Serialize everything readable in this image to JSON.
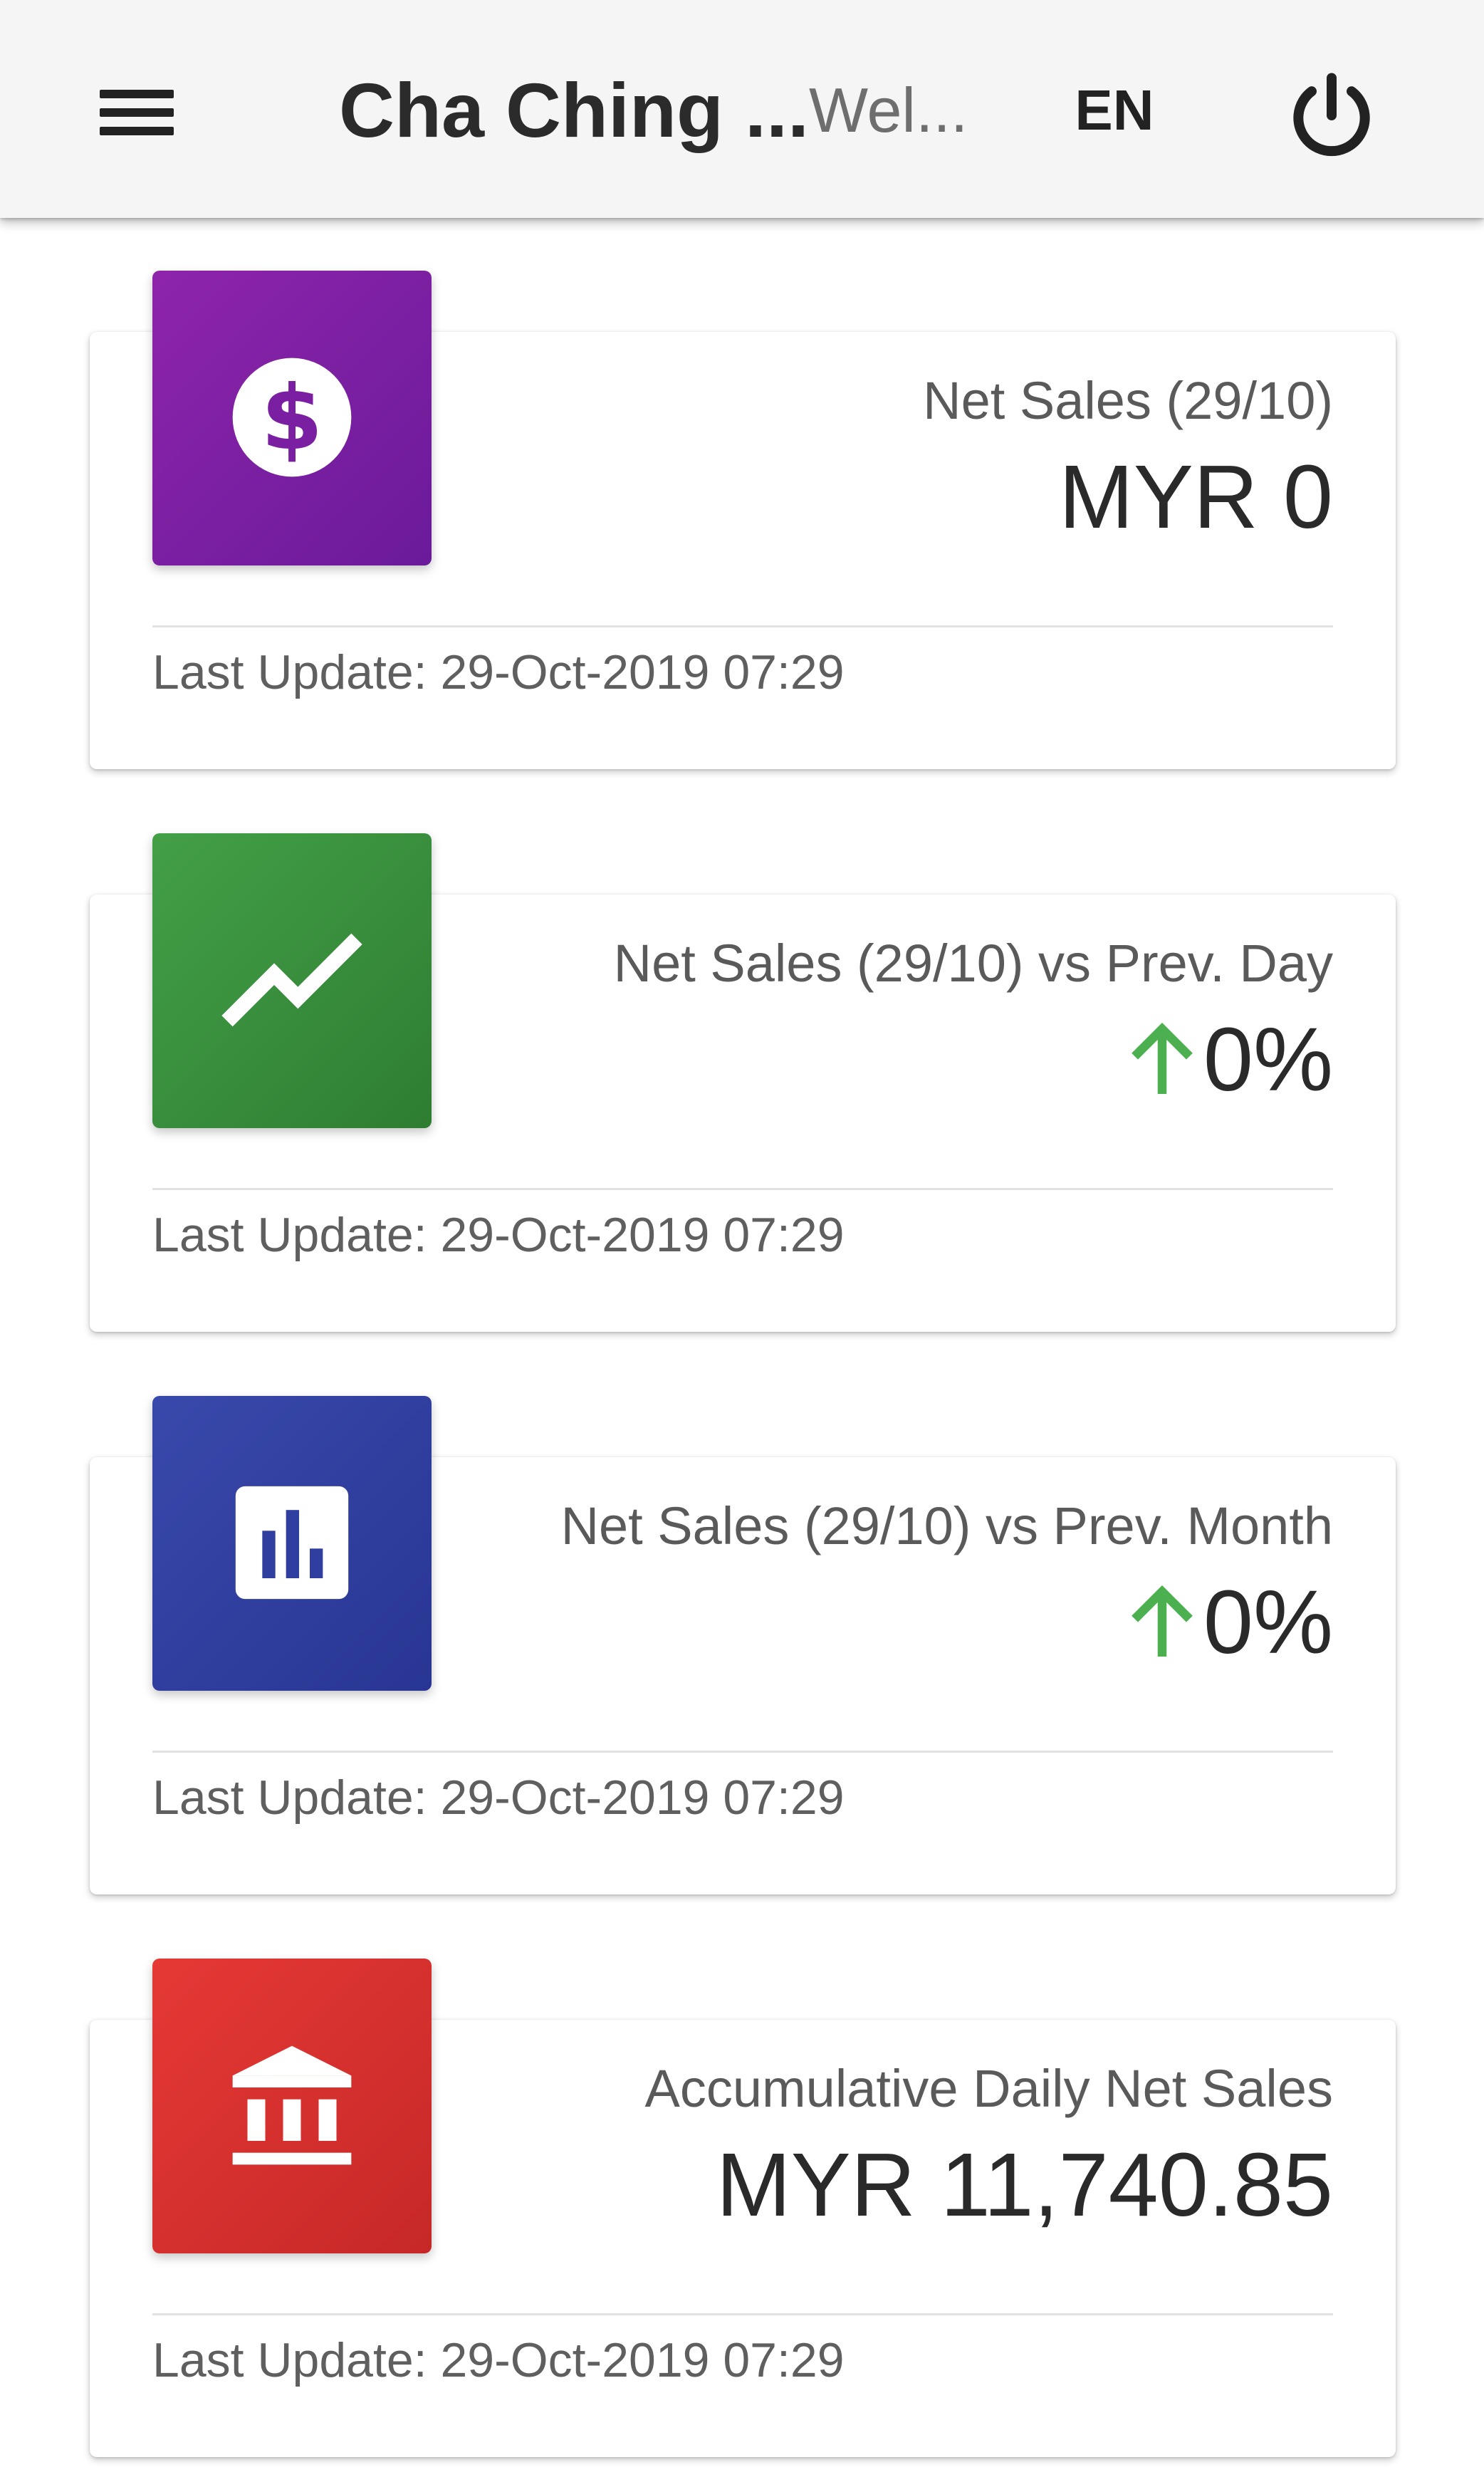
{
  "header": {
    "menu_icon": "hamburger-menu-icon",
    "title": "Cha Ching ...",
    "welcome": "Wel...",
    "language": "EN",
    "power_icon": "power-icon"
  },
  "cards": [
    {
      "icon": "dollar-icon",
      "icon_color": "#7b1fa2",
      "label": "Net Sales (29/10)",
      "value": "MYR 0",
      "trend_icon": null,
      "footer": "Last Update: 29-Oct-2019 07:29"
    },
    {
      "icon": "trending-up-icon",
      "icon_color": "#388e3c",
      "label": "Net Sales (29/10) vs Prev. Day",
      "value": "0%",
      "trend_icon": "arrow-up-icon",
      "trend_color": "#4caf50",
      "footer": "Last Update: 29-Oct-2019 07:29"
    },
    {
      "icon": "bar-chart-icon",
      "icon_color": "#303f9f",
      "label": "Net Sales (29/10) vs Prev. Month",
      "value": "0%",
      "trend_icon": "arrow-up-icon",
      "trend_color": "#4caf50",
      "footer": "Last Update: 29-Oct-2019 07:29"
    },
    {
      "icon": "bank-icon",
      "icon_color": "#d32f2f",
      "label": "Accumulative Daily Net Sales",
      "value": "MYR 11,740.85",
      "trend_icon": null,
      "footer": "Last Update: 29-Oct-2019 07:29"
    }
  ]
}
